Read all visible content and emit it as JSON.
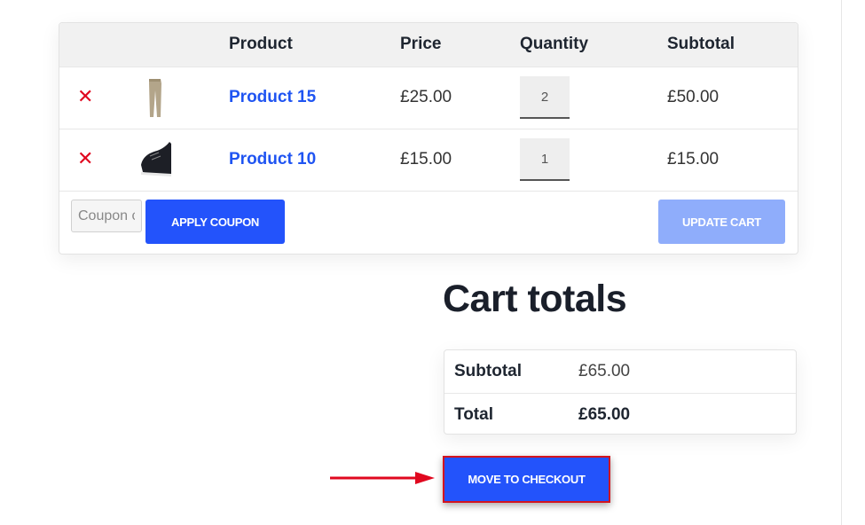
{
  "cart": {
    "headers": {
      "remove": "",
      "thumbnail": "",
      "product": "Product",
      "price": "Price",
      "quantity": "Quantity",
      "subtotal": "Subtotal"
    },
    "items": [
      {
        "remove_icon": "x-icon",
        "thumbnail_icon": "trousers-icon",
        "name": "Product 15",
        "price": "£25.00",
        "quantity": "2",
        "subtotal": "£50.00"
      },
      {
        "remove_icon": "x-icon",
        "thumbnail_icon": "sneaker-icon",
        "name": "Product 10",
        "price": "£15.00",
        "quantity": "1",
        "subtotal": "£15.00"
      }
    ],
    "coupon": {
      "placeholder": "Coupon code",
      "value": ""
    },
    "apply_coupon_label": "APPLY COUPON",
    "update_cart_label": "UPDATE CART"
  },
  "cart_totals": {
    "title": "Cart totals",
    "rows": [
      {
        "label": "Subtotal",
        "value": "£65.00"
      },
      {
        "label": "Total",
        "value": "£65.00"
      }
    ]
  },
  "checkout": {
    "label": "MOVE TO CHECKOUT"
  },
  "colors": {
    "accent": "#2353fb",
    "accent_disabled": "#8fadfb",
    "remove": "#e0081f",
    "link": "#1f54f2",
    "highlight_border": "#d3141e"
  }
}
